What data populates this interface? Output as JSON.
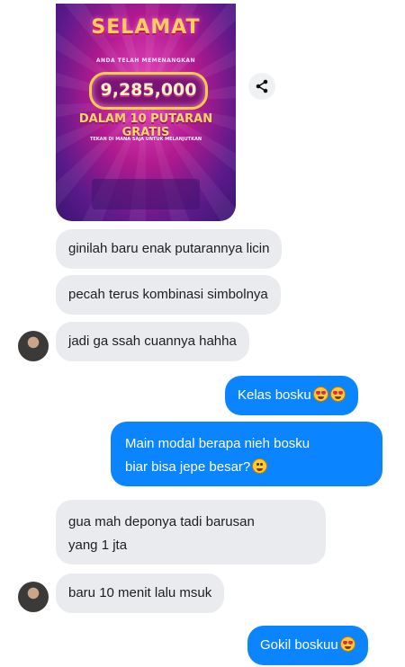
{
  "win_image": {
    "title": "SELAMAT",
    "subtitle": "ANDA TELAH MEMENANGKAN",
    "amount": "9,285,000",
    "free_spins": "DALAM 10 PUTARAN GRATIS",
    "note": "TEKAN DI MANA SAJA UNTUK MELANJUTKAN"
  },
  "share_icon": "share-icon",
  "messages": [
    {
      "side": "in",
      "text": "ginilah baru enak putarannya licin"
    },
    {
      "side": "in",
      "text": "pecah terus kombinasi simbolnya"
    },
    {
      "side": "in",
      "text": "jadi ga ssah cuannya hahha"
    },
    {
      "side": "out",
      "text": "Kelas bosku",
      "emoji": [
        "heart-eyes",
        "heart-eyes"
      ]
    },
    {
      "side": "out",
      "line1": "Main modal berapa nieh bosku",
      "line2": "biar bisa jepe besar?",
      "emoji": [
        "grin"
      ]
    },
    {
      "side": "in",
      "line1": "gua mah deponya tadi barusan",
      "line2": "yang 1 jta"
    },
    {
      "side": "in",
      "text": "baru 10 menit lalu msuk"
    },
    {
      "side": "out",
      "text": "Gokil boskuu",
      "emoji": [
        "heart-eyes"
      ]
    }
  ],
  "colors": {
    "incoming_bubble": "#e9ebef",
    "outgoing_bubble": "#0a84ff",
    "incoming_text": "#1c1e21",
    "outgoing_text": "#ffffff"
  }
}
